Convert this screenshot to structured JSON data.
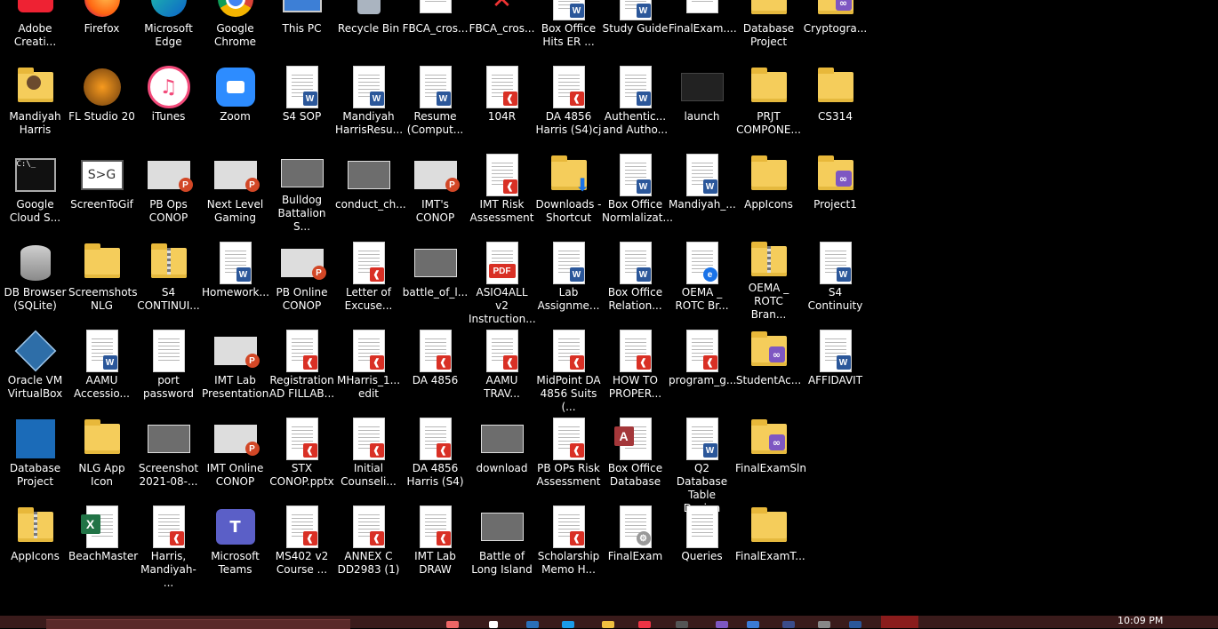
{
  "desktop": {
    "icons": [
      {
        "label": "Adobe\nCreati...",
        "icon": "adobe-cc-icon"
      },
      {
        "label": "Firefox",
        "icon": "firefox-icon"
      },
      {
        "label": "Microsoft\nEdge",
        "icon": "edge-icon"
      },
      {
        "label": "Google\nChrome",
        "icon": "chrome-icon"
      },
      {
        "label": "This PC",
        "icon": "this-pc-icon"
      },
      {
        "label": "Recycle Bin",
        "icon": "recycle-bin-icon"
      },
      {
        "label": "FBCA_cros...",
        "icon": "generic-file-icon"
      },
      {
        "label": "FBCA_cros...",
        "icon": "broken-file-icon"
      },
      {
        "label": "Box Office\nHits ER ...",
        "icon": "word-doc-icon"
      },
      {
        "label": "Study Guide",
        "icon": "word-doc-icon"
      },
      {
        "label": "FinalExam....",
        "icon": "generic-file-icon"
      },
      {
        "label": "Database\nProject",
        "icon": "folder-icon"
      },
      {
        "label": "Cryptogra...",
        "icon": "visual-studio-project-icon"
      },
      {
        "label": "Mandiyah\nHarris",
        "icon": "user-folder-icon"
      },
      {
        "label": "FL Studio 20",
        "icon": "fl-studio-icon"
      },
      {
        "label": "iTunes",
        "icon": "itunes-icon"
      },
      {
        "label": "Zoom",
        "icon": "zoom-icon"
      },
      {
        "label": "S4 SOP",
        "icon": "word-doc-icon"
      },
      {
        "label": "Mandiyah\nHarrisResu...",
        "icon": "word-doc-icon"
      },
      {
        "label": "Resume\n(Comput...",
        "icon": "word-doc-icon"
      },
      {
        "label": "104R",
        "icon": "pdf-icon"
      },
      {
        "label": "DA 4856\nHarris (S4)cj",
        "icon": "pdf-icon"
      },
      {
        "label": "Authentic...\nand Autho...",
        "icon": "word-doc-icon"
      },
      {
        "label": "launch",
        "icon": "video-thumbnail-icon"
      },
      {
        "label": "PRJT\nCOMPONE...",
        "icon": "folder-icon"
      },
      {
        "label": "CS314",
        "icon": "folder-icon"
      },
      {
        "label": "Google\nCloud S...",
        "icon": "terminal-icon"
      },
      {
        "label": "ScreenToGif",
        "icon": "screentogif-icon"
      },
      {
        "label": "PB Ops\nCONOP",
        "icon": "powerpoint-icon"
      },
      {
        "label": "Next Level\nGaming",
        "icon": "powerpoint-icon"
      },
      {
        "label": "Bulldog\nBattalion S...",
        "icon": "image-thumbnail-icon"
      },
      {
        "label": "conduct_ch...",
        "icon": "image-thumbnail-icon"
      },
      {
        "label": "IMT's\nCONOP",
        "icon": "powerpoint-icon"
      },
      {
        "label": "IMT Risk\nAssessment",
        "icon": "pdf-icon"
      },
      {
        "label": "Downloads -\nShortcut",
        "icon": "downloads-folder-icon"
      },
      {
        "label": "Box Office\nNormlalizat...",
        "icon": "word-doc-icon"
      },
      {
        "label": "Mandiyah_...",
        "icon": "word-doc-icon"
      },
      {
        "label": "AppIcons",
        "icon": "folder-icon"
      },
      {
        "label": "Project1",
        "icon": "visual-studio-project-icon"
      },
      {
        "label": "DB Browser\n(SQLite)",
        "icon": "database-icon"
      },
      {
        "label": "Screemshots\nNLG",
        "icon": "folder-icon"
      },
      {
        "label": "S4\nCONTINUI...",
        "icon": "zip-folder-icon"
      },
      {
        "label": "Homework...",
        "icon": "word-doc-icon"
      },
      {
        "label": "PB Online\nCONOP",
        "icon": "powerpoint-icon"
      },
      {
        "label": "Letter of\nExcuse...",
        "icon": "pdf-icon"
      },
      {
        "label": "battle_of_l...",
        "icon": "image-thumbnail-icon"
      },
      {
        "label": "ASIO4ALL v2\nInstruction...",
        "icon": "pdf-large-icon"
      },
      {
        "label": "Lab\nAssignme...",
        "icon": "word-doc-icon"
      },
      {
        "label": "Box Office\nRelation...",
        "icon": "word-doc-icon"
      },
      {
        "label": "OEMA _\nROTC Br...",
        "icon": "edge-doc-icon"
      },
      {
        "label": "OEMA _\nROTC Bran...",
        "icon": "zip-folder-icon"
      },
      {
        "label": "S4 Continuity",
        "icon": "word-doc-icon"
      },
      {
        "label": "Oracle VM\nVirtualBox",
        "icon": "virtualbox-icon"
      },
      {
        "label": "AAMU\nAccessio...",
        "icon": "word-doc-icon"
      },
      {
        "label": "port\npassword",
        "icon": "text-file-icon"
      },
      {
        "label": "IMT Lab\nPresentation",
        "icon": "powerpoint-icon"
      },
      {
        "label": "Registration\nAD FILLAB...",
        "icon": "pdf-icon"
      },
      {
        "label": "MHarris_1...\nedit",
        "icon": "pdf-icon"
      },
      {
        "label": "DA 4856",
        "icon": "pdf-icon"
      },
      {
        "label": "AAMU\nTRAV...",
        "icon": "pdf-icon"
      },
      {
        "label": "MidPoint DA\n4856 Suits (...",
        "icon": "pdf-icon"
      },
      {
        "label": "HOW TO\nPROPER...",
        "icon": "pdf-icon"
      },
      {
        "label": "program_g...",
        "icon": "pdf-icon"
      },
      {
        "label": "StudentAc...",
        "icon": "visual-studio-project-icon"
      },
      {
        "label": "AFFIDAVIT",
        "icon": "word-doc-icon"
      },
      {
        "label": "Database\nProject",
        "icon": "database-zip-icon"
      },
      {
        "label": "NLG App\nIcon",
        "icon": "folder-icon"
      },
      {
        "label": "Screenshot\n2021-08-...",
        "icon": "image-thumbnail-icon"
      },
      {
        "label": "IMT Online\nCONOP",
        "icon": "powerpoint-icon"
      },
      {
        "label": "STX\nCONOP.pptx",
        "icon": "pdf-icon"
      },
      {
        "label": "Initial\nCounseli...",
        "icon": "pdf-icon"
      },
      {
        "label": "DA 4856\nHarris (S4)",
        "icon": "pdf-icon"
      },
      {
        "label": "download",
        "icon": "image-thumbnail-icon"
      },
      {
        "label": "PB OPs Risk\nAssessment",
        "icon": "pdf-icon"
      },
      {
        "label": "Box Office\nDatabase",
        "icon": "access-db-icon"
      },
      {
        "label": "Q2 Database\nTable Design",
        "icon": "word-doc-icon"
      },
      {
        "label": "FinalExamSln",
        "icon": "visual-studio-project-icon"
      },
      {
        "label": "AppIcons",
        "icon": "zip-folder-icon"
      },
      {
        "label": "BeachMaster",
        "icon": "excel-icon"
      },
      {
        "label": "Harris,\nMandiyah- ...",
        "icon": "pdf-icon"
      },
      {
        "label": "Microsoft\nTeams",
        "icon": "teams-icon"
      },
      {
        "label": "MS402 v2\nCourse ...",
        "icon": "pdf-icon"
      },
      {
        "label": "ANNEX C\nDD2983 (1)",
        "icon": "pdf-icon"
      },
      {
        "label": "IMT Lab\nDRAW",
        "icon": "pdf-icon"
      },
      {
        "label": "Battle of\nLong Island",
        "icon": "image-thumbnail-icon"
      },
      {
        "label": "Scholarship\nMemo H...",
        "icon": "pdf-icon"
      },
      {
        "label": "FinalExam",
        "icon": "settings-file-icon"
      },
      {
        "label": "Queries",
        "icon": "text-file-icon"
      },
      {
        "label": "FinalExamT...",
        "icon": "folder-icon"
      }
    ]
  },
  "taskbar": {
    "clock": "10:09 PM"
  },
  "colors": {
    "desktop_bg": "#000000",
    "taskbar_bg": "#3a1b1b",
    "taskbar_active": "#8a1c1c"
  }
}
